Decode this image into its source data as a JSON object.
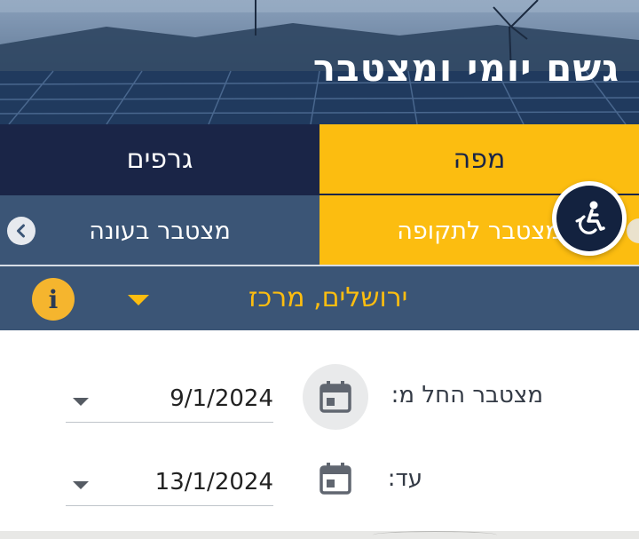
{
  "header": {
    "title": "גשם יומי ומצטבר"
  },
  "tabs": [
    {
      "label": "גרפים",
      "selected": false
    },
    {
      "label": "מפה",
      "selected": true
    }
  ],
  "subtabs": [
    {
      "label": "מצטבר בעונה",
      "selected": false
    },
    {
      "label": "מצטבר לתקופה",
      "selected": true
    }
  ],
  "location": {
    "selected": "ירושלים, מרכז",
    "icons": {
      "dropdown": "caret-down-icon",
      "info": "info-icon"
    }
  },
  "accessibility": {
    "icon": "wheelchair-icon"
  },
  "form": {
    "from": {
      "label": "מצטבר החל מ:",
      "value": "9/1/2024"
    },
    "to": {
      "label": "עד:",
      "value": "13/1/2024"
    }
  },
  "colors": {
    "navy": "#1a2547",
    "slate": "#3b5576",
    "accent_yellow": "#fcbd10"
  }
}
